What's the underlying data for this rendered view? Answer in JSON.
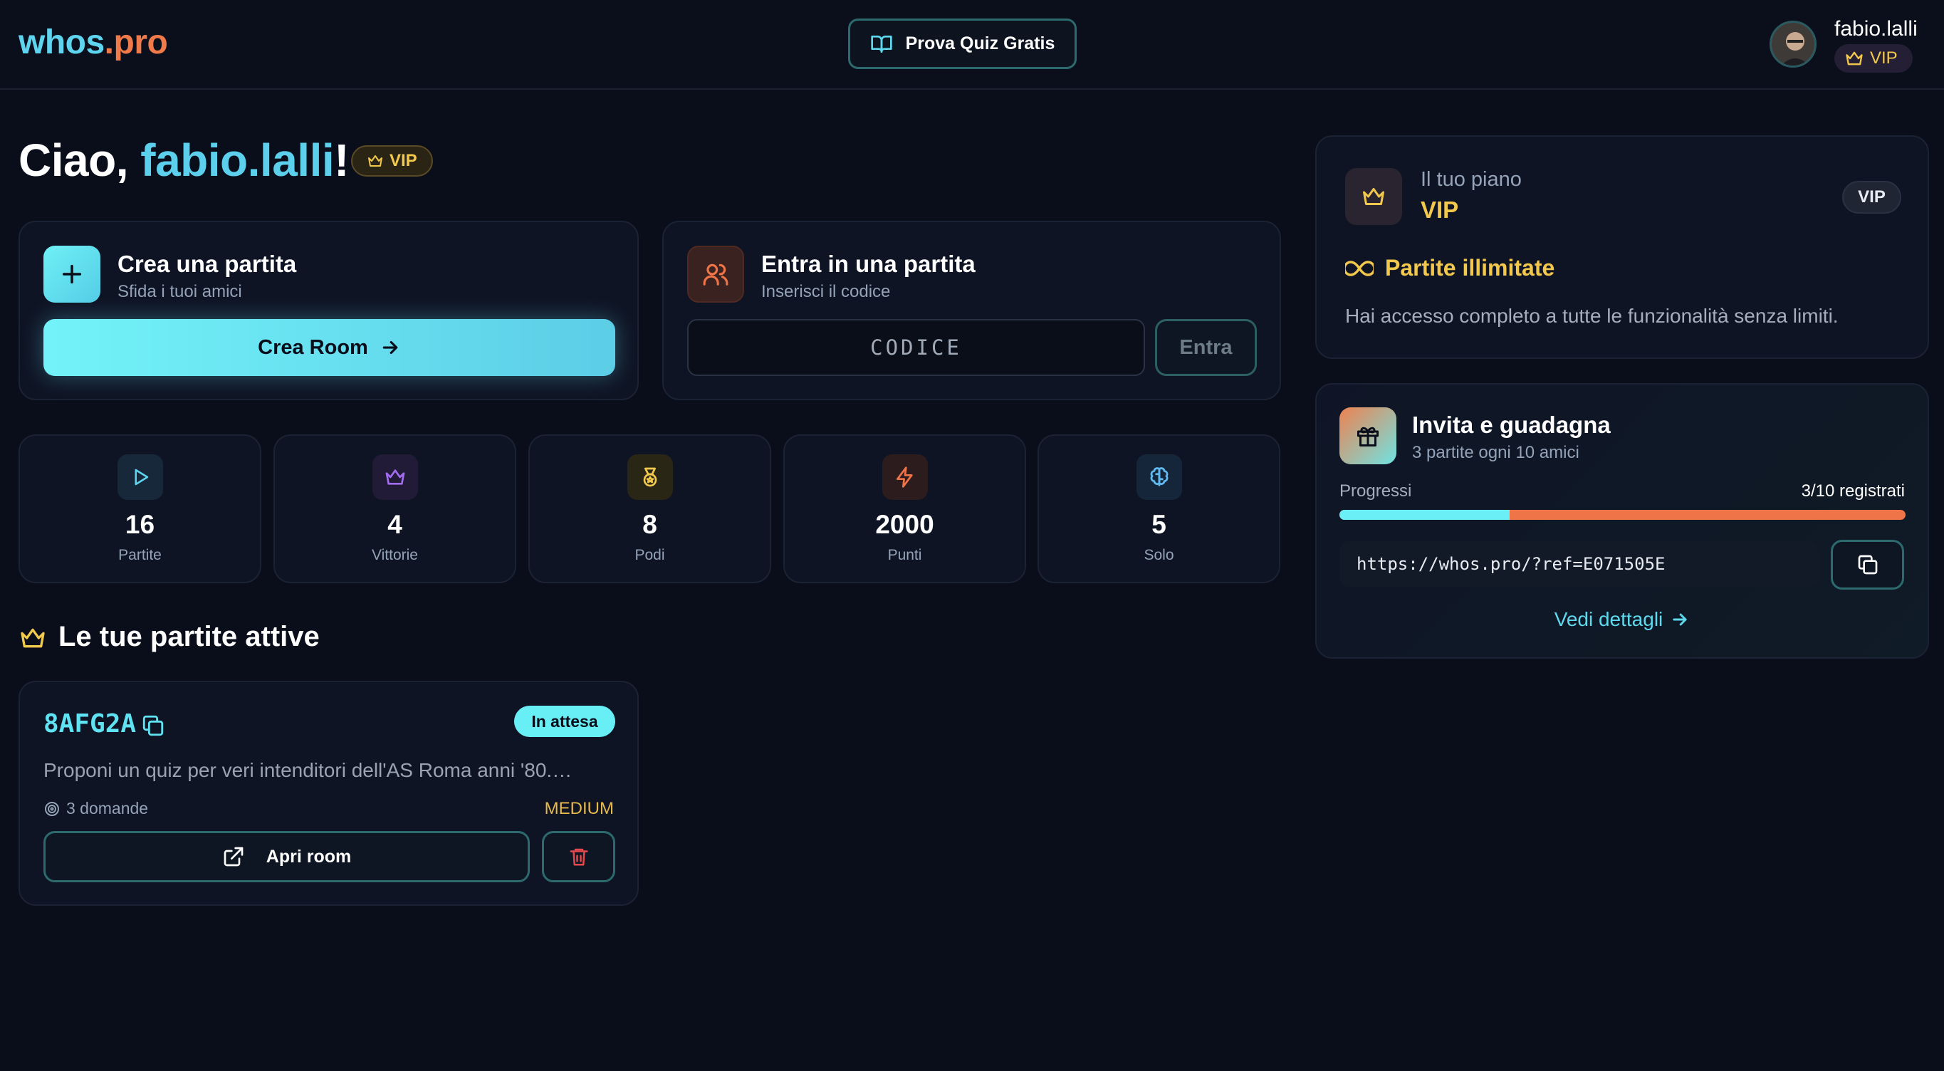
{
  "header": {
    "logo_part1": "whos",
    "logo_part2": ".pro",
    "try_quiz_label": "Prova Quiz Gratis",
    "user": {
      "name": "fabio.lalli",
      "badge": "VIP"
    }
  },
  "greeting": {
    "prefix": "Ciao, ",
    "name": "fabio.lalli",
    "suffix": "!",
    "badge": "VIP"
  },
  "create_card": {
    "title": "Crea una partita",
    "subtitle": "Sfida i tuoi amici",
    "button_label": "Crea Room",
    "icon": "plus-icon"
  },
  "join_card": {
    "title": "Entra in una partita",
    "subtitle": "Inserisci il codice",
    "input_placeholder": "CODICE",
    "input_value": "",
    "button_label": "Entra",
    "icon": "users-icon"
  },
  "stats": [
    {
      "value": "16",
      "label": "Partite",
      "icon": "play-icon",
      "color": "#5fd4ee"
    },
    {
      "value": "4",
      "label": "Vittorie",
      "icon": "crown-icon",
      "color": "#a26cf0"
    },
    {
      "value": "8",
      "label": "Podi",
      "icon": "medal-icon",
      "color": "#f2c94c"
    },
    {
      "value": "2000",
      "label": "Punti",
      "icon": "zap-icon",
      "color": "#ef7448"
    },
    {
      "value": "5",
      "label": "Solo",
      "icon": "brain-icon",
      "color": "#5fb9ee"
    }
  ],
  "active_games": {
    "title": "Le tue partite attive",
    "rooms": [
      {
        "code": "8AFG2A",
        "status": "In attesa",
        "description": "Proponi un quiz per veri intenditori dell'AS Roma anni '80.…",
        "questions": "3 domande",
        "difficulty": "MEDIUM",
        "open_label": "Apri room"
      }
    ]
  },
  "plan_card": {
    "label": "Il tuo piano",
    "name": "VIP",
    "pill": "VIP",
    "feature": "Partite illimitate",
    "description": "Hai accesso completo a tutte le funzionalità senza limiti."
  },
  "invite_card": {
    "title": "Invita e guadagna",
    "subtitle": "3 partite ogni 10 amici",
    "progress_label": "Progressi",
    "progress_count": "3/10 registrati",
    "progress_fraction": 0.3,
    "referral_url": "https://whos.pro/?ref=E071505E",
    "details_label": "Vedi dettagli"
  },
  "colors": {
    "background": "#0a0e1a",
    "accent_cyan": "#5fd4ee",
    "accent_orange": "#ef7448",
    "vip_gold": "#f2c94c"
  }
}
